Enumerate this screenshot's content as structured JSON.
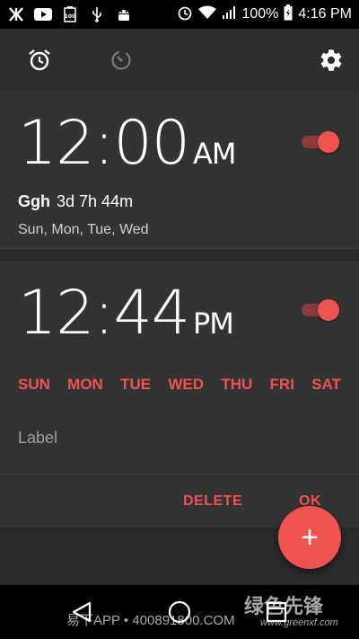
{
  "status_bar": {
    "battery": "100%",
    "time": "4:16 PM",
    "notif_icons": [
      "k-icon",
      "youtube-icon",
      "battery-100-icon",
      "usb-icon",
      "android-debug-icon"
    ],
    "sys_icons": [
      "alarm-icon",
      "wifi-icon",
      "signal-icon",
      "battery-charging-icon"
    ]
  },
  "toolbar": {
    "tabs": [
      "alarm-icon",
      "timer-icon"
    ],
    "settings": "gear-icon"
  },
  "alarm1": {
    "time": "12:00",
    "ampm": "AM",
    "label": "Ggh",
    "remaining": "3d 7h 44m",
    "days": "Sun, Mon, Tue, Wed",
    "enabled": true
  },
  "alarm2": {
    "time": "12:44",
    "ampm": "PM",
    "enabled": true,
    "days": [
      "SUN",
      "MON",
      "TUE",
      "WED",
      "THU",
      "FRI",
      "SAT"
    ],
    "label_placeholder": "Label",
    "delete": "DELETE",
    "ok": "OK"
  },
  "fab": "+",
  "watermark": {
    "left": "易下APP • 400891800.COM",
    "right": "绿色先锋",
    "url": "www.greenxf.com"
  },
  "colors": {
    "accent": "#ef5350",
    "toggle_track": "#8c3a3a",
    "card": "#333333",
    "background": "#2a2a2a"
  }
}
